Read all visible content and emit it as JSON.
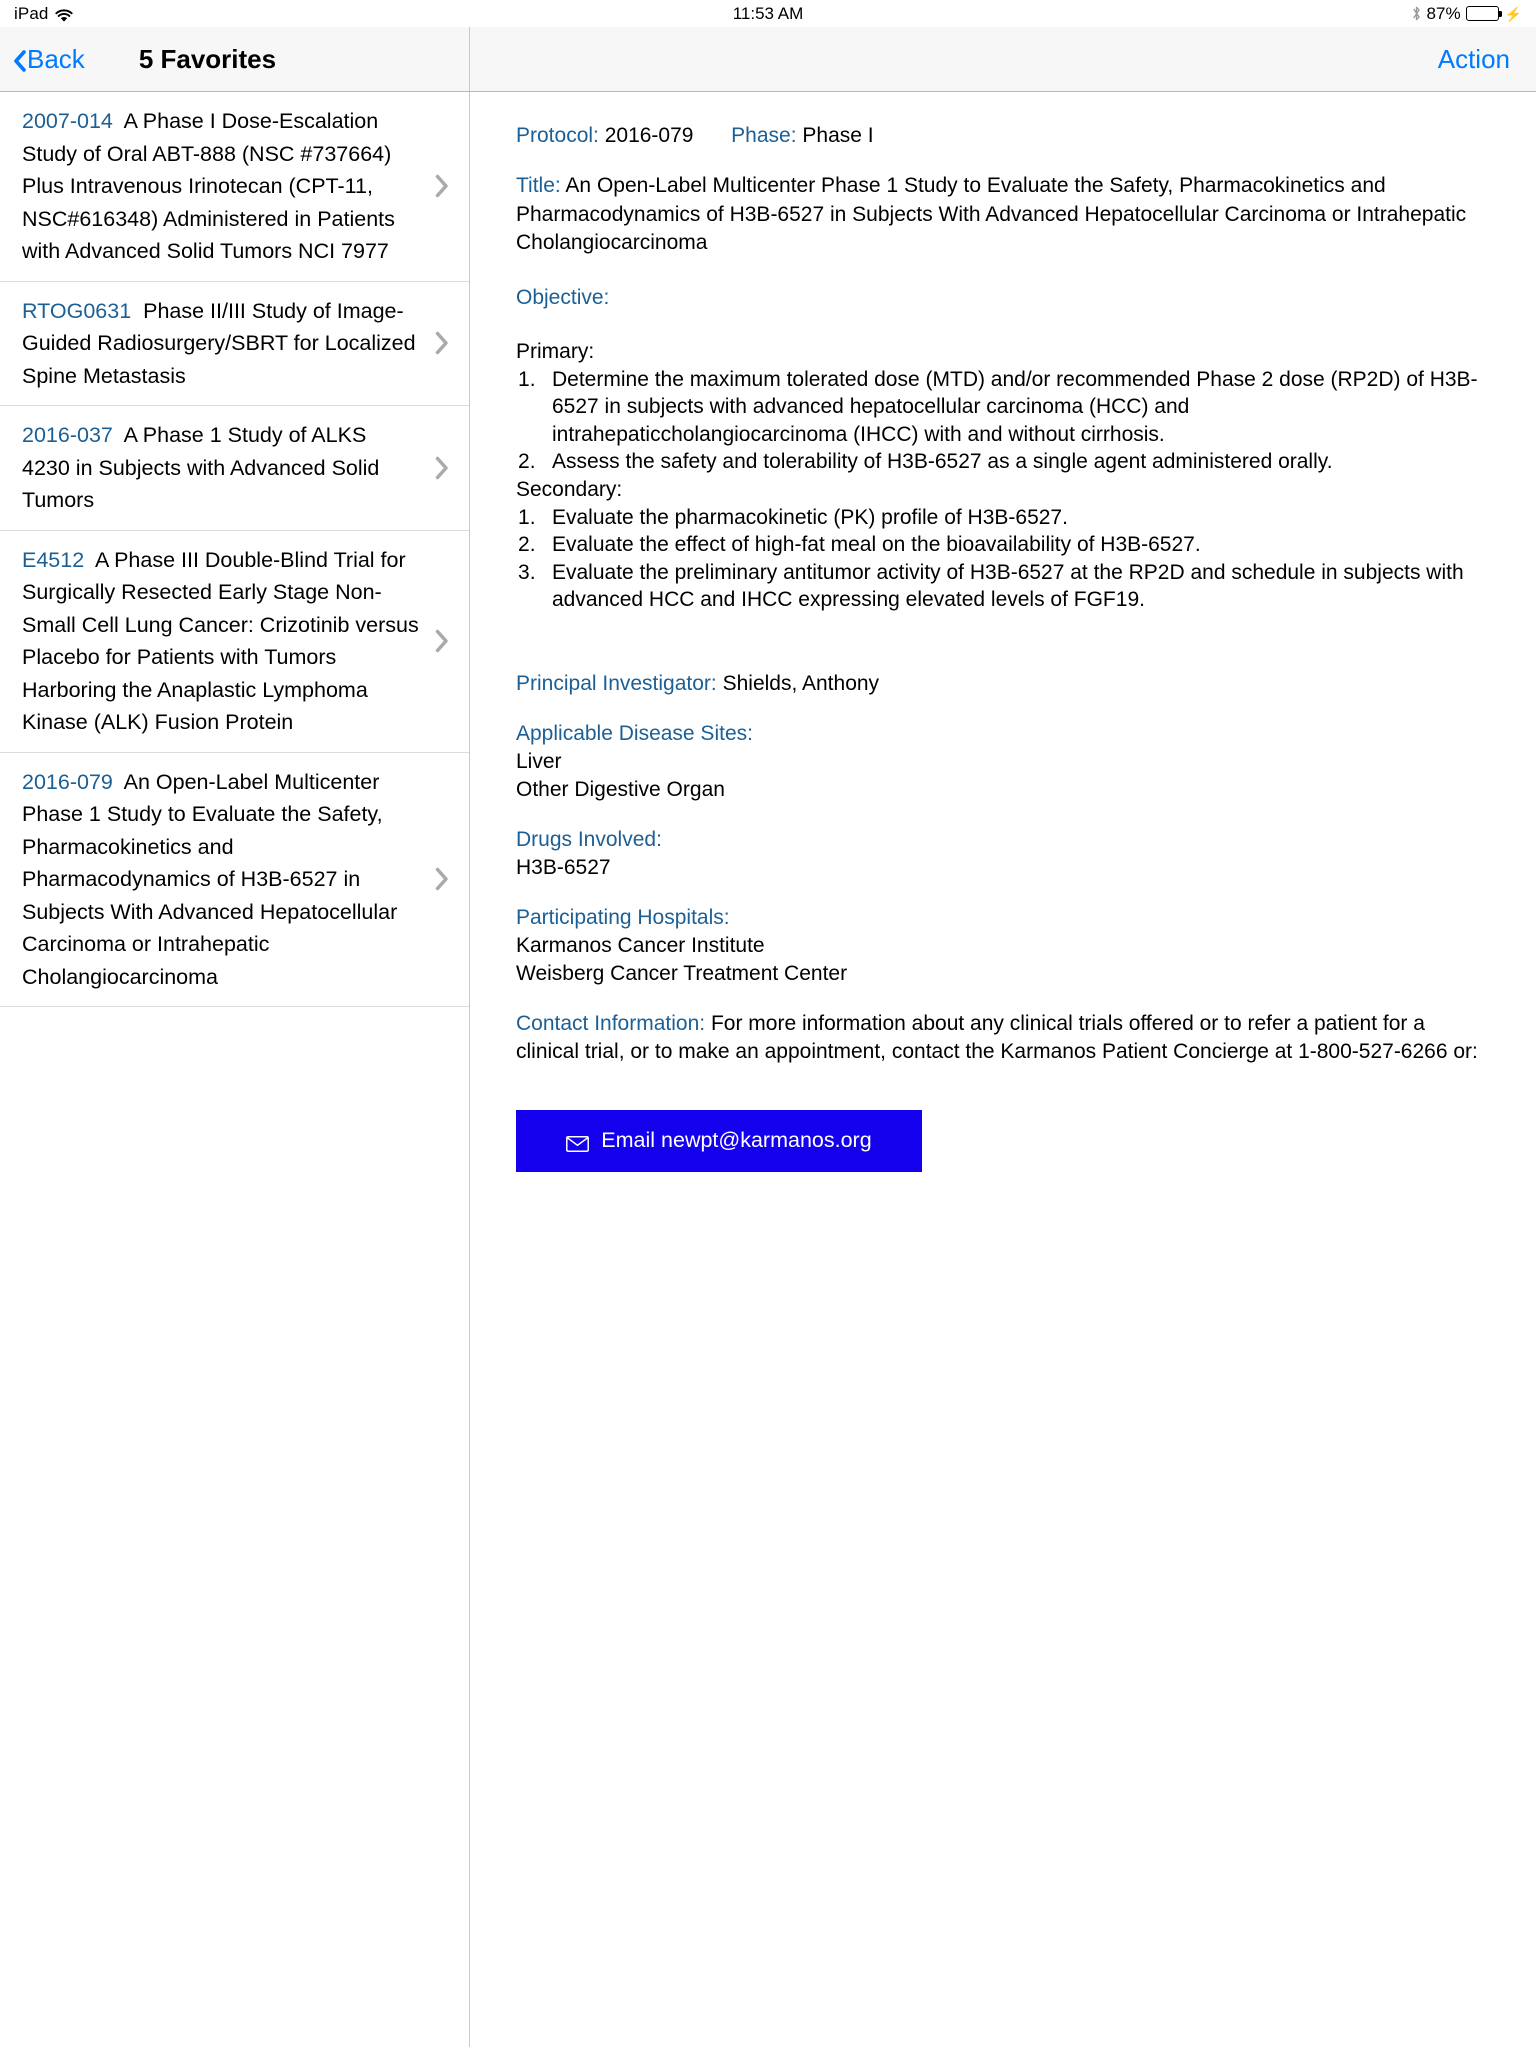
{
  "status_bar": {
    "device": "iPad",
    "wifi_icon": "wifi-icon",
    "time": "11:53 AM",
    "bluetooth_icon": "bluetooth-icon",
    "battery_percent": "87%",
    "battery_level": 87,
    "charging_icon": "lightning-bolt-icon"
  },
  "nav_bar": {
    "back_label": "Back",
    "back_icon": "chevron-left-icon",
    "title": "5 Favorites",
    "action_label": "Action"
  },
  "list": {
    "items": [
      {
        "protocol": "2007-014",
        "title": "A Phase I Dose-Escalation Study of Oral ABT-888 (NSC #737664) Plus Intravenous Irinotecan (CPT-11, NSC#616348) Administered in Patients with Advanced Solid Tumors NCI 7977",
        "disclosure_icon": "chevron-right-icon"
      },
      {
        "protocol": "RTOG0631",
        "title": "Phase II/III Study of Image-Guided Radiosurgery/SBRT for Localized Spine Metastasis",
        "disclosure_icon": "chevron-right-icon"
      },
      {
        "protocol": "2016-037",
        "title": "A Phase 1 Study of ALKS 4230 in Subjects with Advanced Solid Tumors",
        "disclosure_icon": "chevron-right-icon"
      },
      {
        "protocol": "E4512",
        "title": "A Phase III Double-Blind Trial for Surgically Resected Early Stage Non-Small Cell Lung Cancer: Crizotinib versus Placebo for Patients with Tumors Harboring the Anaplastic Lymphoma Kinase (ALK) Fusion Protein",
        "disclosure_icon": "chevron-right-icon"
      },
      {
        "protocol": "2016-079",
        "title": "An Open-Label Multicenter Phase 1 Study to Evaluate the Safety, Pharmacokinetics and Pharmacodynamics of H3B-6527 in Subjects With Advanced Hepatocellular Carcinoma or Intrahepatic Cholangiocarcinoma",
        "disclosure_icon": "chevron-right-icon"
      }
    ]
  },
  "detail": {
    "protocol_label": "Protocol:",
    "protocol_value": "2016-079",
    "phase_label": "Phase:",
    "phase_value": "Phase I",
    "title_label": "Title:",
    "title_value": "An Open-Label Multicenter Phase 1 Study to Evaluate the Safety, Pharmacokinetics and Pharmacodynamics of H3B-6527 in Subjects With Advanced Hepatocellular Carcinoma or Intrahepatic Cholangiocarcinoma",
    "objective_label": "Objective:",
    "primary_label": "Primary:",
    "primary_items": [
      "Determine the maximum tolerated dose (MTD) and/or recommended Phase 2 dose (RP2D) of H3B-6527 in subjects with advanced hepatocellular carcinoma (HCC) and intrahepaticcholangiocarcinoma (IHCC) with and without cirrhosis.",
      "Assess the safety and tolerability of H3B-6527 as a single agent administered orally."
    ],
    "secondary_label": "Secondary:",
    "secondary_items": [
      "Evaluate the pharmacokinetic (PK) profile of H3B-6527.",
      "Evaluate the effect of high-fat meal on the bioavailability of H3B-6527.",
      "Evaluate the preliminary antitumor activity of H3B-6527 at the RP2D and schedule in subjects with advanced HCC and IHCC expressing elevated levels of FGF19."
    ],
    "pi_label": "Principal Investigator:",
    "pi_value": "Shields, Anthony",
    "disease_sites_label": "Applicable Disease Sites:",
    "disease_sites": [
      "Liver",
      "Other Digestive Organ"
    ],
    "drugs_label": "Drugs Involved:",
    "drugs": [
      "H3B-6527"
    ],
    "hospitals_label": "Participating Hospitals:",
    "hospitals": [
      "Karmanos Cancer Institute",
      "Weisberg Cancer Treatment Center"
    ],
    "contact_label": "Contact Information:",
    "contact_text": "For more information about any clinical trials offered or to refer a patient for a clinical trial, or to make an appointment, contact the Karmanos Patient Concierge at 1-800-527-6266 or:",
    "email_button_label": "Email newpt@karmanos.org",
    "email_icon": "envelope-icon"
  },
  "colors": {
    "ios_blue": "#007aff",
    "label_blue": "#1c5f95",
    "email_button_bg": "#1500ee",
    "battery_green": "#4CD964"
  }
}
